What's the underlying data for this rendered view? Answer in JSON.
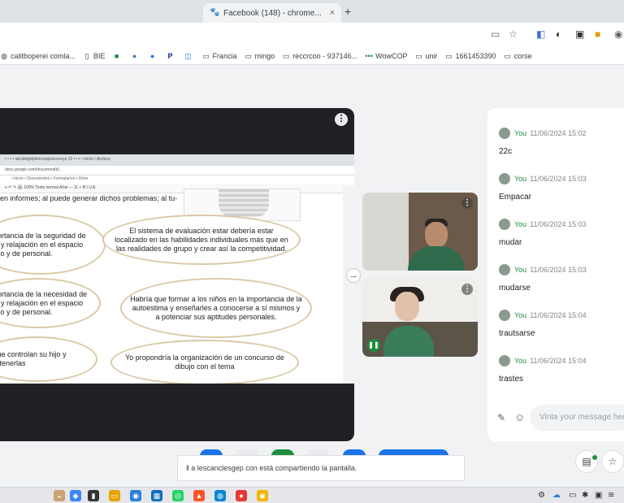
{
  "browser": {
    "tab_title": "Facebook (148) - chrome...",
    "tab_close": "×",
    "new_tab": "+"
  },
  "bookmarks": [
    {
      "label": "calitboperei comla...",
      "icon": "globe-icon"
    },
    {
      "label": "BIE",
      "icon": "page-icon"
    },
    {
      "label": "",
      "icon": "chat-icon"
    },
    {
      "label": "",
      "icon": "meet-icon"
    },
    {
      "label": "",
      "icon": "bookmark-icon"
    },
    {
      "label": "",
      "icon": "paypal-icon"
    },
    {
      "label": "",
      "icon": "doc-icon"
    },
    {
      "label": "Francia",
      "icon": "folder-icon"
    },
    {
      "label": "mingo",
      "icon": "folder-icon"
    },
    {
      "label": "reccrcoo - 937146...",
      "icon": "folder-icon"
    },
    {
      "label": "WowCOP",
      "icon": "dots-icon"
    },
    {
      "label": "unir",
      "icon": "folder-icon"
    },
    {
      "label": "1661453390",
      "icon": "folder-icon"
    },
    {
      "label": "corse",
      "icon": "folder-icon"
    }
  ],
  "shared_screen": {
    "tabs_text": "• • • • abcdefghijklmnopqrstuvwxyz 12 • • • • Inicio • Archivo",
    "address_text": "docs.google.com/document/d/...",
    "bookmarks_text": "• Inicio • Documentos • Formularios • Drive",
    "toolbar_text": "≡ ↶ ↷ 🖨  100%  Texto normal  Arial  — 11 +  B I U A",
    "top_text": "en informes; al puede generar dichos problemas; al tu-",
    "bubbles": [
      "Importancia de la seguridad de ocio y relajación en el espacio lúdico y de personal.",
      "El sistema de evaluación estar debería estar localizado en las habilidades individuales más que en las realidades de grupo y crear así la competitividad.",
      "Importancia de la necesidad de ocio y relajación en el espacio lúdico y de personal.",
      "Habría que formar a los niños en la importancia de la autoestima y enseñarles a conocerse a sí mismos y a potenciar sus aptitudes personales.",
      "lo que controlan su hijo y mantenerlas",
      "Yo propondría la organización de un concurso de dibujo con el tema"
    ]
  },
  "chat": {
    "messages": [
      {
        "sender": "You",
        "time": "11/06/2024 15:02",
        "text": "22c"
      },
      {
        "sender": "You",
        "time": "11/06/2024 15:03",
        "text": "Empacar"
      },
      {
        "sender": "You",
        "time": "11/06/2024 15:03",
        "text": "mudar"
      },
      {
        "sender": "You",
        "time": "11/06/2024 15:03",
        "text": "mudarse"
      },
      {
        "sender": "You",
        "time": "11/06/2024 15:04",
        "text": "trautsarse"
      },
      {
        "sender": "You",
        "time": "11/06/2024 15:04",
        "text": "trastes"
      }
    ],
    "input_placeholder": "Vinta your message here"
  },
  "notice": {
    "text": "a lescanclesgep con está compartiendo la pantalla."
  },
  "colors": {
    "accent_green": "#1e8e3e",
    "present_bg": "#1f2124",
    "bubble_border": "#d9c9a6"
  }
}
